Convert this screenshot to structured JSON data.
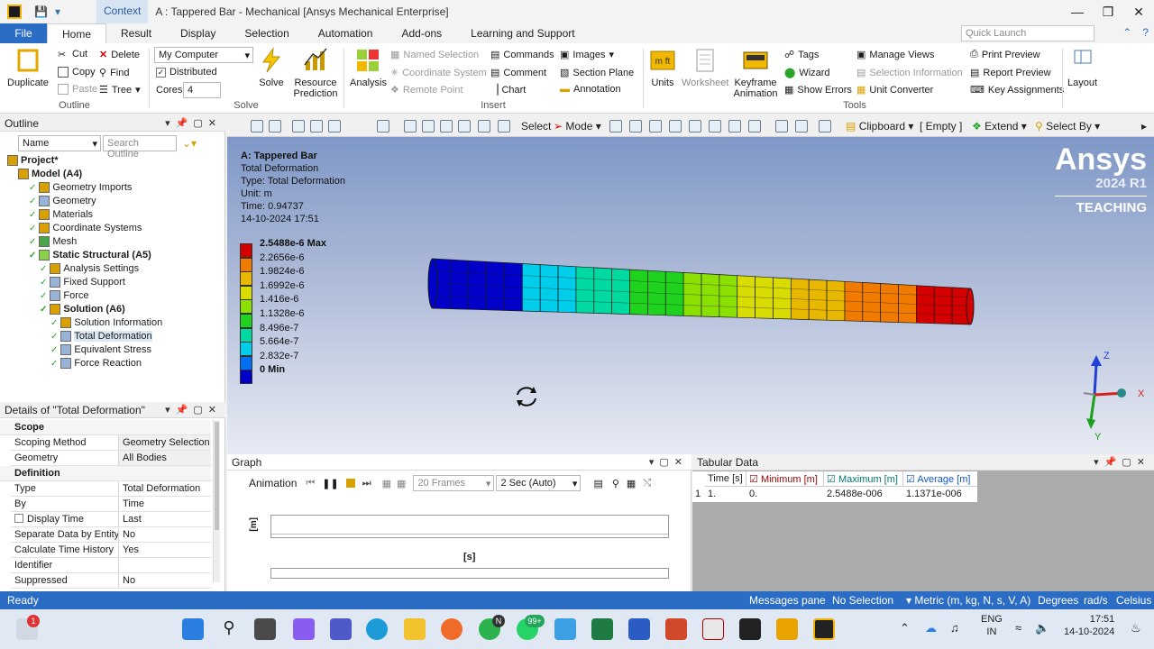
{
  "window": {
    "context_label": "Context",
    "title": "A : Tappered Bar - Mechanical [Ansys Mechanical Enterprise]",
    "controls": [
      "—",
      "❐",
      "✕"
    ]
  },
  "tabs": {
    "file": "File",
    "items": [
      "Home",
      "Result",
      "Display",
      "Selection",
      "Automation",
      "Add-ons",
      "Learning and Support"
    ],
    "quick_launch_placeholder": "Quick Launch"
  },
  "ribbon": {
    "outline_group": {
      "label": "Outline",
      "duplicate": "Duplicate",
      "cut": "Cut",
      "copy": "Copy",
      "paste": "Paste",
      "delete": "Delete",
      "find": "Find",
      "tree": "Tree"
    },
    "solve_group": {
      "label": "Solve",
      "computer_value": "My Computer",
      "distributed": "Distributed",
      "cores_label": "Cores",
      "cores_value": "4",
      "solve": "Solve",
      "resource_prediction": "Resource Prediction"
    },
    "insert_group": {
      "label": "Insert",
      "analysis": "Analysis",
      "named_selection": "Named Selection",
      "coordinate_system": "Coordinate System",
      "remote_point": "Remote Point",
      "commands": "Commands",
      "comment": "Comment",
      "chart": "Chart",
      "images": "Images",
      "section_plane": "Section Plane",
      "annotation": "Annotation"
    },
    "tools_group": {
      "label": "Tools",
      "units": "Units",
      "worksheet": "Worksheet",
      "keyframe_animation": "Keyframe Animation",
      "tags": "Tags",
      "wizard": "Wizard",
      "show_errors": "Show Errors",
      "manage_views": "Manage Views",
      "selection_information": "Selection Information",
      "unit_converter": "Unit Converter",
      "print_preview": "Print Preview",
      "report_preview": "Report Preview",
      "key_assignments": "Key Assignments"
    },
    "layout": "Layout"
  },
  "outline": {
    "title": "Outline",
    "name_filter": "Name",
    "search_placeholder": "Search Outline",
    "tree": [
      {
        "label": "Project*",
        "bold": true
      },
      {
        "label": "Model (A4)",
        "bold": true
      },
      {
        "label": "Geometry Imports",
        "bold": false
      },
      {
        "label": "Geometry",
        "bold": false
      },
      {
        "label": "Materials",
        "bold": false
      },
      {
        "label": "Coordinate Systems",
        "bold": false
      },
      {
        "label": "Mesh",
        "bold": false
      },
      {
        "label": "Static Structural (A5)",
        "bold": true
      },
      {
        "label": "Analysis Settings",
        "bold": false
      },
      {
        "label": "Fixed Support",
        "bold": false
      },
      {
        "label": "Force",
        "bold": false
      },
      {
        "label": "Solution (A6)",
        "bold": true
      },
      {
        "label": "Solution Information",
        "bold": false
      },
      {
        "label": "Total Deformation",
        "bold": false
      },
      {
        "label": "Equivalent Stress",
        "bold": false
      },
      {
        "label": "Force Reaction",
        "bold": false
      }
    ]
  },
  "details": {
    "title": "Details of \"Total Deformation\"",
    "sections": {
      "scope": "Scope",
      "definition": "Definition"
    },
    "rows": [
      {
        "k": "Scoping Method",
        "v": "Geometry Selection"
      },
      {
        "k": "Geometry",
        "v": "All Bodies"
      },
      {
        "k": "Type",
        "v": "Total Deformation"
      },
      {
        "k": "By",
        "v": "Time"
      },
      {
        "k": "Display Time",
        "v": "Last"
      },
      {
        "k": "Separate Data by Entity",
        "v": "No"
      },
      {
        "k": "Calculate Time History",
        "v": "Yes"
      },
      {
        "k": "Identifier",
        "v": ""
      },
      {
        "k": "Suppressed",
        "v": "No"
      }
    ]
  },
  "graphics_toolbar": {
    "select": "Select",
    "mode": "Mode",
    "clipboard": "Clipboard",
    "empty": "[ Empty ]",
    "extend": "Extend",
    "select_by": "Select By"
  },
  "viewport": {
    "info": [
      "A: Tappered Bar",
      "Total Deformation",
      "Type: Total Deformation",
      "Unit: m",
      "Time: 0.94737",
      "14-10-2024 17:51"
    ],
    "legend": [
      {
        "label": "2.5488e-6 Max",
        "color": "#d40000",
        "bold": true
      },
      {
        "label": "2.2656e-6",
        "color": "#f07b00"
      },
      {
        "label": "1.9824e-6",
        "color": "#e8b800"
      },
      {
        "label": "1.6992e-6",
        "color": "#d8dc00"
      },
      {
        "label": "1.416e-6",
        "color": "#8ae000"
      },
      {
        "label": "1.1328e-6",
        "color": "#1ed21e"
      },
      {
        "label": "8.496e-7",
        "color": "#00d9a0"
      },
      {
        "label": "5.664e-7",
        "color": "#00cdea"
      },
      {
        "label": "2.832e-7",
        "color": "#0070f0"
      },
      {
        "label": "0 Min",
        "color": "#0000c8",
        "bold": true
      }
    ],
    "brand_name": "Ansys",
    "brand_version": "2024 R1",
    "brand_edition": "TEACHING",
    "axes": {
      "x": "X",
      "y": "Y",
      "z": "Z"
    }
  },
  "graph": {
    "title": "Graph",
    "animation": "Animation",
    "frames": "20 Frames",
    "duration": "2 Sec (Auto)",
    "y_unit": "[m]",
    "x_unit": "[s]"
  },
  "tabular": {
    "title": "Tabular Data",
    "headers": [
      "Time [s]",
      "Minimum [m]",
      "Maximum [m]",
      "Average [m]"
    ],
    "row": [
      "1",
      "1.",
      "0.",
      "2.5488e-006",
      "1.1371e-006"
    ]
  },
  "status": {
    "ready": "Ready",
    "messages": "Messages pane",
    "selection": "No Selection",
    "units": "Metric (m, kg, N, s, V, A)",
    "degrees": "Degrees",
    "rads": "rad/s",
    "celsius": "Celsius"
  },
  "taskbar": {
    "notification_badge": "1",
    "whatsapp_badge": "99+",
    "chrome_badge": "N",
    "language_top": "ENG",
    "language_bottom": "IN",
    "time": "17:51",
    "date": "14-10-2024"
  }
}
